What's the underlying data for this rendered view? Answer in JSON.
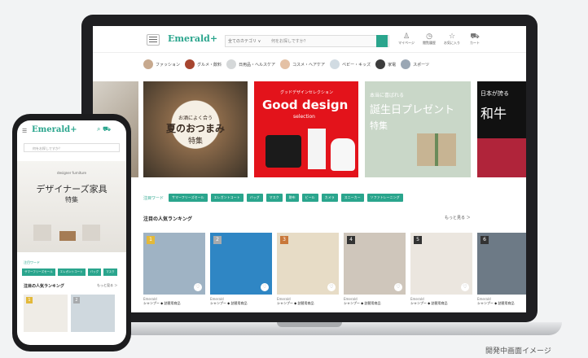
{
  "site": {
    "logo": "Emerald+"
  },
  "search": {
    "category": "全てのカテゴリ ∨",
    "placeholder": "何をお探しですか？"
  },
  "header_icons": [
    {
      "name": "account",
      "label": "マイページ",
      "glyph": "♙"
    },
    {
      "name": "history",
      "label": "閲覧履歴",
      "glyph": "◷"
    },
    {
      "name": "favorite",
      "label": "お気に入り",
      "glyph": "☆"
    },
    {
      "name": "cart",
      "label": "カート",
      "glyph": "⛟"
    }
  ],
  "categories": [
    "ファッション",
    "グルメ・飲料",
    "日用品・ヘルスケア",
    "コスメ・ヘアケア",
    "ベビー・キッズ",
    "家電",
    "スポーツ"
  ],
  "banners": {
    "natsu": {
      "kicker": "お酒によく合う",
      "title": "夏のおつまみ",
      "sub": "特集"
    },
    "good_design": {
      "kicker": "グッドデザインセレクション",
      "title": "Good design",
      "sub": "selection"
    },
    "birthday": {
      "kicker": "本当に喜ばれる",
      "title": "誕生日プレゼント",
      "sub": "特集"
    },
    "wagyu": {
      "kicker": "日本が誇る",
      "title": "和牛"
    }
  },
  "keywords": {
    "label": "注目ワード",
    "items": [
      "サマーフリーズセール",
      "エレガントコート",
      "バッグ",
      "マスク",
      "財布",
      "ビール",
      "カメラ",
      "スニーカー",
      "ソファトレーニング"
    ]
  },
  "ranking": {
    "title": "注目の人気ランキング",
    "more": "もっと見る ＞",
    "items": [
      {
        "rank": "1",
        "brand": "Emerald",
        "name": "シャンプー ◆ 詰替用商品",
        "rank_color": "#e3b93a",
        "img": "#9fb3c4"
      },
      {
        "rank": "2",
        "brand": "Emerald",
        "name": "シャンプー ◆ 詰替用商品",
        "rank_color": "#a7aaad",
        "img": "#2f86c4"
      },
      {
        "rank": "3",
        "brand": "Emerald",
        "name": "シャンプー ◆ 詰替用商品",
        "rank_color": "#c9783a",
        "img": "#e7dcc6"
      },
      {
        "rank": "4",
        "brand": "Emerald",
        "name": "シャンプー ◆ 詰替用商品",
        "rank_color": "#333333",
        "img": "#cfc6bb"
      },
      {
        "rank": "5",
        "brand": "Emerald",
        "name": "シャンプー ◆ 詰替用商品",
        "rank_color": "#333333",
        "img": "#ebe6df"
      },
      {
        "rank": "6",
        "brand": "Emerald",
        "name": "シャンプー ◆ 詰替用商品",
        "rank_color": "#333333",
        "img": "#6d7a86"
      }
    ]
  },
  "phone": {
    "search_placeholder": "何をお探しですか？",
    "banner_small": "designer furniture",
    "banner_title": "デザイナーズ家具",
    "banner_sub": "特集",
    "kw_label": "注目ワード",
    "chips": [
      "サマーフリーズセール",
      "エレガントコート",
      "バッグ",
      "マスク"
    ],
    "rank_title": "注目の人気ランキング",
    "rank_more": "もっと見る ＞",
    "cards": [
      {
        "rank": "1",
        "brand": "Emerald"
      },
      {
        "rank": "2",
        "brand": "Emerald"
      }
    ]
  },
  "caption": "開発中画面イメージ"
}
